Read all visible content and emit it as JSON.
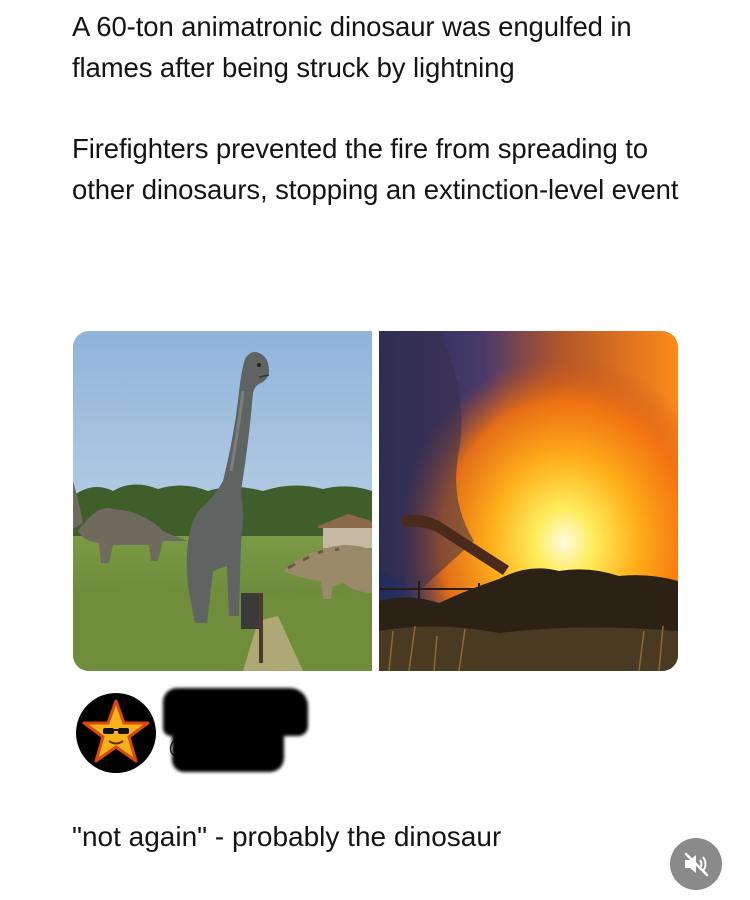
{
  "post": {
    "paragraph_1": "A 60-ton animatronic dinosaur was engulfed in flames after being struck by lightning",
    "paragraph_2": "Firefighters prevented the fire from spreading to other dinosaurs, stopping an extinction-level event"
  },
  "media": {
    "left_photo": "dinosaur-park-photo",
    "right_photo": "fire-photo"
  },
  "author": {
    "avatar_icon": "star-with-sunglasses-icon",
    "name_fragment": "C",
    "handle_fragment": "@"
  },
  "caption": "\"not again\" - probably the dinosaur",
  "controls": {
    "mute_icon": "speaker-muted-icon"
  },
  "colors": {
    "text": "#141414",
    "mute_button_bg": "#8a8a8a",
    "avatar_star": "#f5b21b"
  }
}
